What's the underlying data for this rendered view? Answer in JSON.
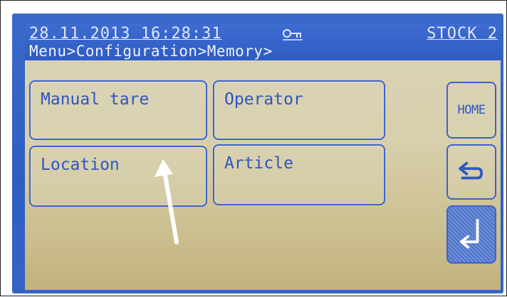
{
  "status_bar": {
    "datetime": "28.11.2013 16:28:31",
    "mode": "STOCK 2",
    "key_icon": "key-icon"
  },
  "breadcrumb": "Menu>Configuration>Memory>",
  "tiles": [
    {
      "label": "Manual tare"
    },
    {
      "label": "Operator"
    },
    {
      "label": "Location"
    },
    {
      "label": "Article"
    }
  ],
  "side_buttons": {
    "home_label": "HOME",
    "back_icon": "back-arrow-icon",
    "enter_icon": "enter-return-icon"
  },
  "colors": {
    "accent_blue": "#2f56c0",
    "bezel_blue": "#3260c4",
    "screen_beige": "#d8cfab",
    "annotation_arrow": "#ffffff"
  }
}
